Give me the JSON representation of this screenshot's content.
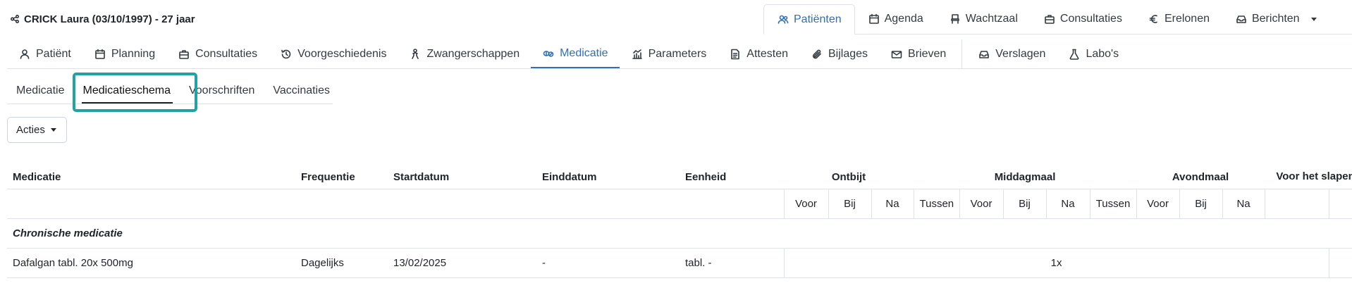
{
  "header": {
    "patient_title": "CRICK Laura (03/10/1997) - 27 jaar",
    "patient_icon": "share-nodes-icon"
  },
  "main_nav": [
    {
      "label": "Patiënten",
      "icon": "users-icon",
      "active": true
    },
    {
      "label": "Agenda",
      "icon": "calendar-icon",
      "active": false
    },
    {
      "label": "Wachtzaal",
      "icon": "chair-icon",
      "active": false
    },
    {
      "label": "Consultaties",
      "icon": "briefcase-icon",
      "active": false
    },
    {
      "label": "Erelonen",
      "icon": "euro-icon",
      "active": false
    },
    {
      "label": "Berichten",
      "icon": "inbox-icon",
      "active": false
    }
  ],
  "sub_nav": [
    {
      "label": "Patiënt",
      "icon": "user-icon"
    },
    {
      "label": "Planning",
      "icon": "calendar-icon"
    },
    {
      "label": "Consultaties",
      "icon": "briefcase-icon"
    },
    {
      "label": "Voorgeschiedenis",
      "icon": "history-icon"
    },
    {
      "label": "Zwangerschappen",
      "icon": "baby-icon"
    },
    {
      "label": "Medicatie",
      "icon": "pills-icon",
      "active": true
    },
    {
      "label": "Parameters",
      "icon": "chart-icon"
    },
    {
      "label": "Attesten",
      "icon": "document-icon"
    },
    {
      "label": "Bijlages",
      "icon": "paperclip-icon"
    },
    {
      "label": "Brieven",
      "icon": "mail-icon"
    },
    {
      "label": "Verslagen",
      "icon": "inbox-icon"
    },
    {
      "label": "Labo's",
      "icon": "flask-icon"
    }
  ],
  "tabs": [
    {
      "label": "Medicatie"
    },
    {
      "label": "Medicatieschema",
      "active": true
    },
    {
      "label": "Voorschriften"
    },
    {
      "label": "Vaccinaties"
    }
  ],
  "actions_label": "Acties",
  "table": {
    "headers": {
      "medicatie": "Medicatie",
      "frequentie": "Frequentie",
      "startdatum": "Startdatum",
      "einddatum": "Einddatum",
      "eenheid": "Eenheid",
      "ontbijt": "Ontbijt",
      "middagmaal": "Middagmaal",
      "avondmaal": "Avondmaal",
      "voor_het_slapen": "Voor het slapen"
    },
    "sub_headers": [
      "Voor",
      "Bij",
      "Na",
      "Tussen",
      "Voor",
      "Bij",
      "Na",
      "Tussen",
      "Voor",
      "Bij",
      "Na"
    ],
    "section_label": "Chronische medicatie",
    "rows": [
      {
        "medicatie": "Dafalgan tabl. 20x 500mg",
        "frequentie": "Dagelijks",
        "startdatum": "13/02/2025",
        "einddatum": "-",
        "eenheid": "tabl. -",
        "dosering": "1x"
      }
    ]
  },
  "colors": {
    "accent": "#2f6fb8",
    "highlight": "#1fa3a3",
    "border": "#dee2e6"
  }
}
